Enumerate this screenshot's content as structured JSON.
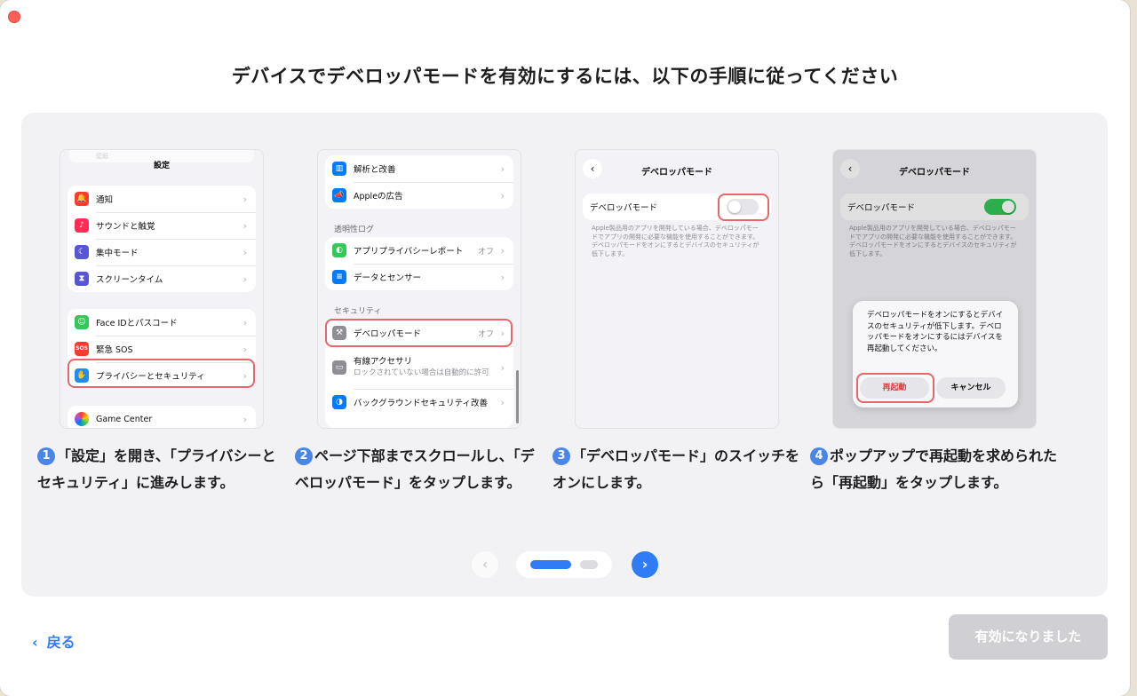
{
  "title": "デバイスでデベロッパモードを有効にするには、以下の手順に従ってください",
  "steps": [
    {
      "num": "1",
      "caption": "「設定」を開き、「プライバシーとセキュリティ」に進みします。",
      "screen": {
        "header": "設定",
        "top_item": "壁紙",
        "group1": [
          "通知",
          "サウンドと触覚",
          "集中モード",
          "スクリーンタイム"
        ],
        "group2": [
          "Face IDとパスコード",
          "緊急 SOS",
          "プライバシーとセキュリティ"
        ],
        "group3": [
          "Game Center"
        ]
      }
    },
    {
      "num": "2",
      "caption": "ページ下部までスクロールし、「デベロッパモード」をタップします。",
      "screen": {
        "item_analytics": "解析と改善",
        "item_ads": "Appleの広告",
        "section_transparency": "透明性ログ",
        "item_privacy_report": "アプリプライバシーレポート",
        "item_privacy_report_value": "オフ",
        "item_data_sensors": "データとセンサー",
        "section_security": "セキュリティ",
        "item_dev_mode": "デベロッパモード",
        "item_dev_mode_value": "オフ",
        "item_wired": "有線アクセサリ",
        "item_wired_sub": "ロックされていない場合は自動的に許可",
        "item_bg_security": "バックグラウンドセキュリティ改善"
      }
    },
    {
      "num": "3",
      "caption": "「デベロッパモード」のスイッチをオンにします。",
      "screen": {
        "header": "デベロッパモード",
        "toggle_label": "デベロッパモード",
        "toggle_on": false,
        "description": "Apple製品用のアプリを開発している場合、デベロッパモードでアプリの開発に必要な機能を使用することができます。デベロッパモードをオンにするとデバイスのセキュリティが低下します。"
      }
    },
    {
      "num": "4",
      "caption": "ポップアップで再起動を求められたら「再起動」をタップします。",
      "screen": {
        "header": "デベロッパモード",
        "toggle_label": "デベロッパモード",
        "toggle_on": true,
        "description": "Apple製品用のアプリを開発している場合、デベロッパモードでアプリの開発に必要な機能を使用することができます。デベロッパモードをオンにするとデバイスのセキュリティが低下します。",
        "alert_text": "デベロッパモードをオンにするとデバイスのセキュリティが低下します。デベロッパモードをオンにするにはデバイスを再起動してください。",
        "restart_label": "再起動",
        "cancel_label": "キャンセル"
      }
    }
  ],
  "pager": {
    "current": 1,
    "total": 2
  },
  "footer": {
    "back_label": "戻る",
    "done_label": "有効になりました"
  },
  "colors": {
    "accent": "#2f7cf6",
    "highlight": "#e8666b",
    "toggle_on": "#34c759",
    "disabled": "#cfcfd4"
  }
}
